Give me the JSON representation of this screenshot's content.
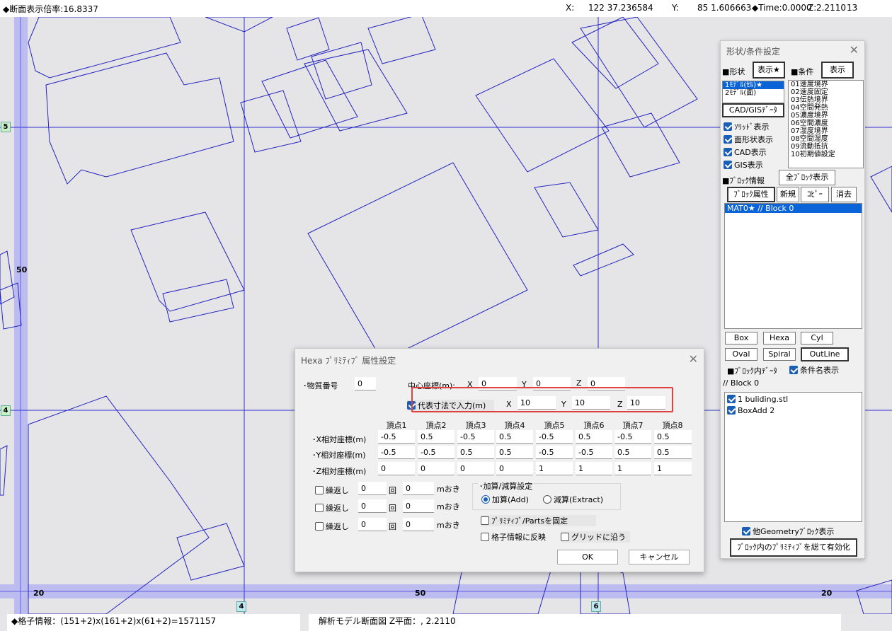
{
  "topbar": {
    "scale_label": "◆断面表示倍率:16.8337",
    "x_label": "X:",
    "x_value": "122  37.236584",
    "y_label": "Y:",
    "y_value": "85  1.606663",
    "time_label": "◆Time:0.0000",
    "z_label": "Z:",
    "z_value": "2.2110",
    "tail_value": "13"
  },
  "grid_labels": {
    "left_5": "5",
    "left_50": "50",
    "left_4": "4",
    "bottom_20a": "20",
    "bottom_50": "50",
    "bottom_20b": "20",
    "bottom_box_4": "4",
    "bottom_box_6": "6"
  },
  "bottombar": {
    "grid_info": "◆格子情報：(151+2)x(161+2)x(61+2)=1571157",
    "section_info": "解析モデル断面図 Z平面：, 2.2110"
  },
  "panel": {
    "title": "形状/条件設定",
    "shape_label": "■形状",
    "shape_show_btn": "表示★",
    "cond_label": "■条件",
    "cond_show_btn": "表示",
    "shape_list": [
      "1ﾓﾃﾞﾙ(ｾﾙ)★",
      "2ﾓﾃﾞﾙ(面)"
    ],
    "cond_list": [
      "01速度境界",
      "02速度固定",
      "03伝熱境界",
      "04空間発熱",
      "05濃度境界",
      "06空間濃度",
      "07湿度境界",
      "08空間湿度",
      "09流動抵抗",
      "10初期値設定"
    ],
    "cadgis_btn": "CAD/GISﾃﾞｰﾀ",
    "chk_solid": "ｿﾘｯﾄﾞ表示",
    "chk_surface": "面形状表示",
    "chk_cad": "CAD表示",
    "chk_gis": "GIS表示",
    "block_info_label": "■ﾌﾞﾛｯｸ情報",
    "all_block_btn": "全ﾌﾞﾛｯｸ表示",
    "block_attr_btn": "ﾌﾞﾛｯｸ属性",
    "new_btn": "新規",
    "copy_btn": "ｺﾋﾟｰ",
    "delete_btn": "消去",
    "block_list": [
      "MAT0★ // Block 0"
    ],
    "box_btn": "Box",
    "hexa_btn": "Hexa",
    "cyl_btn": "Cyl",
    "oval_btn": "Oval",
    "spiral_btn": "Spiral",
    "outline_btn": "OutLine",
    "block_data_label": "■ﾌﾞﾛｯｸ内ﾃﾞｰﾀ",
    "chk_condname": "条件名表示",
    "block_name": "// Block 0",
    "block_items": [
      "1 buliding.stl",
      "BoxAdd 2"
    ],
    "chk_other_geom": "他Geometryﾌﾞﾛｯｸ表示",
    "enable_all_btn": "ﾌﾞﾛｯｸ内のﾌﾟﾘﾐﾃｨﾌﾞを総て有効化"
  },
  "dialog": {
    "title": "Hexa ﾌﾟﾘﾐﾃｨﾌﾞ 属性設定",
    "material_label": "･物質番号",
    "material_value": "0",
    "center_label": "中心座標(m):",
    "cx_label": "X",
    "cx_value": "0",
    "cy_label": "Y",
    "cy_value": "0",
    "cz_label": "Z",
    "cz_value": "0",
    "rep_label": "代表寸法で入力(m)",
    "rx_label": "X",
    "rx_value": "10",
    "ry_label": "Y",
    "ry_value": "10",
    "rz_label": "Z",
    "rz_value": "10",
    "vertex_headers": [
      "頂点1",
      "頂点2",
      "頂点3",
      "頂点4",
      "頂点5",
      "頂点6",
      "頂点7",
      "頂点8"
    ],
    "row_labels": [
      "･X相対座標(m)",
      "･Y相対座標(m)",
      "･Z相対座標(m)"
    ],
    "x_values": [
      "-0.5",
      "0.5",
      "-0.5",
      "0.5",
      "-0.5",
      "0.5",
      "-0.5",
      "0.5"
    ],
    "y_values": [
      "-0.5",
      "-0.5",
      "0.5",
      "0.5",
      "-0.5",
      "-0.5",
      "0.5",
      "0.5"
    ],
    "z_values": [
      "0",
      "0",
      "0",
      "0",
      "1",
      "1",
      "1",
      "1"
    ],
    "repeat_label": "繰返し",
    "times_label": "回",
    "interval_label": "mおき",
    "repeat_rows": [
      {
        "count": "0",
        "interval": "0"
      },
      {
        "count": "0",
        "interval": "0"
      },
      {
        "count": "0",
        "interval": "0"
      }
    ],
    "addsub_label": "･加算/減算設定",
    "add_label": "加算(Add)",
    "extract_label": "減算(Extract)",
    "fix_label": "ﾌﾟﾘﾐﾃｨﾌﾞ/Partsを固定",
    "reflect_label": "格子情報に反映",
    "grid_follow_label": "グリッドに沿う",
    "ok_btn": "OK",
    "cancel_btn": "キャンセル"
  }
}
